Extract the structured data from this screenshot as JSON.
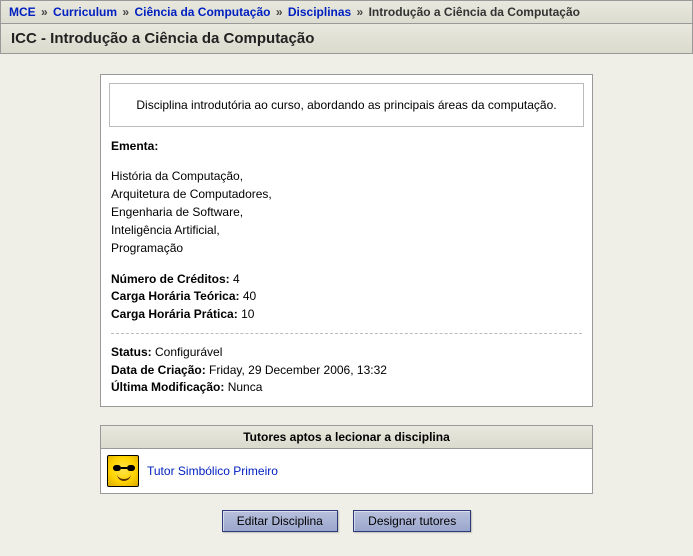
{
  "breadcrumb": {
    "items": [
      {
        "label": "MCE"
      },
      {
        "label": "Curriculum"
      },
      {
        "label": "Ciência da Computação"
      },
      {
        "label": "Disciplinas"
      }
    ],
    "current": "Introdução a Ciência da Computação"
  },
  "page_title": "ICC - Introdução a Ciência da Computação",
  "intro_text": "Disciplina introdutória ao curso, abordando as principais áreas da computação.",
  "ementa_label": "Ementa:",
  "ementa_lines": [
    "História da Computação,",
    "Arquitetura de Computadores,",
    "Engenharia de Software,",
    "Inteligência Artificial,",
    "Programação"
  ],
  "credits": {
    "label": "Número de Créditos:",
    "value": "4"
  },
  "teorica": {
    "label": "Carga Horária Teórica:",
    "value": "40"
  },
  "pratica": {
    "label": "Carga Horária Prática:",
    "value": "10"
  },
  "status": {
    "label": "Status:",
    "value": "Configurável"
  },
  "created": {
    "label": "Data de Criação:",
    "value": "Friday, 29 December 2006, 13:32"
  },
  "modified": {
    "label": "Última Modificação:",
    "value": "Nunca"
  },
  "tutors_header": "Tutores aptos a lecionar a disciplina",
  "tutors": [
    {
      "name": "Tutor Simbólico Primeiro"
    }
  ],
  "buttons": {
    "edit": "Editar Disciplina",
    "assign": "Designar tutores"
  }
}
